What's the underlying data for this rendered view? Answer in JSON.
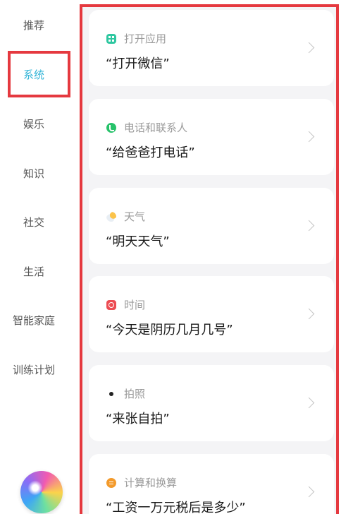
{
  "sidebar": {
    "items": [
      {
        "label": "推荐"
      },
      {
        "label": "系统"
      },
      {
        "label": "娱乐"
      },
      {
        "label": "知识"
      },
      {
        "label": "社交"
      },
      {
        "label": "生活"
      },
      {
        "label": "智能家庭"
      },
      {
        "label": "训练计划"
      }
    ],
    "active_index": 1,
    "active_color": "#2fb3d6",
    "highlight_color": "#e5393f"
  },
  "cards": [
    {
      "category": "打开应用",
      "phrase": "“打开微信”",
      "icon": "app-grid-icon"
    },
    {
      "category": "电话和联系人",
      "phrase": "“给爸爸打电话”",
      "icon": "phone-icon"
    },
    {
      "category": "天气",
      "phrase": "“明天天气”",
      "icon": "weather-icon"
    },
    {
      "category": "时间",
      "phrase": "“今天是阴历几月几号”",
      "icon": "clock-icon"
    },
    {
      "category": "拍照",
      "phrase": "“来张自拍”",
      "icon": "camera-dot-icon"
    },
    {
      "category": "计算和换算",
      "phrase": "“工资一万元税后是多少”",
      "icon": "calculator-icon"
    }
  ]
}
